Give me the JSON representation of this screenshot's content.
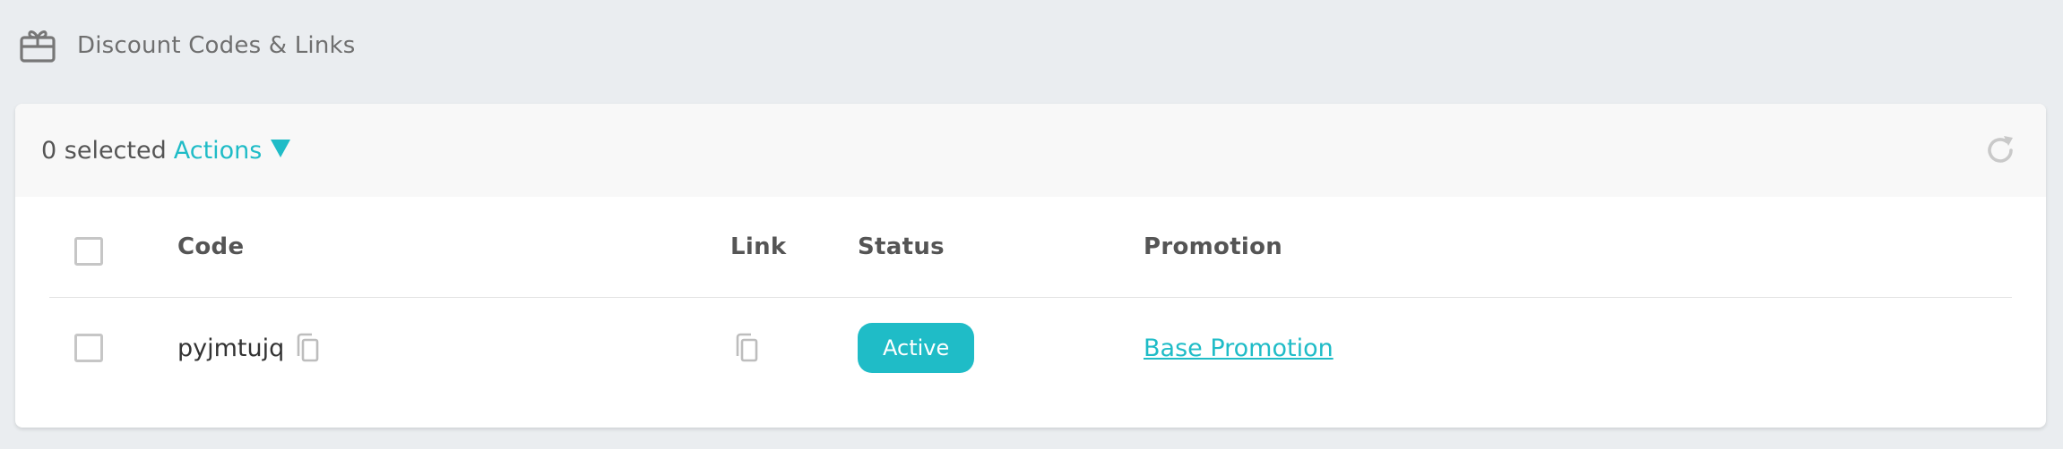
{
  "header": {
    "title": "Discount Codes & Links",
    "icon": "gift-card-icon"
  },
  "toolbar": {
    "selected_label": "0 selected",
    "actions_label": "Actions",
    "refresh_icon": "refresh-icon"
  },
  "table": {
    "columns": {
      "code": "Code",
      "link": "Link",
      "status": "Status",
      "promotion": "Promotion"
    },
    "rows": [
      {
        "code": "pyjmtujq",
        "status": "Active",
        "promotion": "Base Promotion"
      }
    ]
  },
  "colors": {
    "accent": "#1fbcc7",
    "background": "#eaedf0",
    "toolbar_bg": "#f8f8f8",
    "card_bg": "#ffffff"
  }
}
